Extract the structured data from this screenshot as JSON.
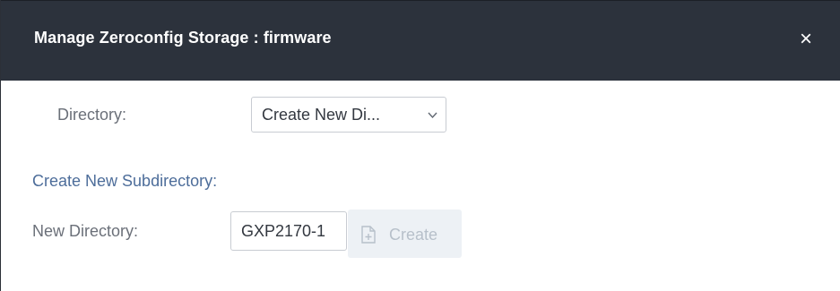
{
  "dialog": {
    "title": "Manage Zeroconfig Storage : firmware",
    "close_glyph": "×",
    "close_icon": "close-icon"
  },
  "directory": {
    "label": "Directory:",
    "selected_value": "Create New Di...",
    "arrow_icon": "chevron-down-icon"
  },
  "subdirectory": {
    "section_title": "Create New Subdirectory:",
    "label": "New Directory:",
    "input_value": "GXP2170-1",
    "create_label": "Create",
    "create_icon": "new-file-icon",
    "create_enabled": false
  },
  "colors": {
    "titlebar": "#2c323c",
    "section_title": "#4d6d9a",
    "label": "#6b7079",
    "disabled_button_bg": "#edf1f5",
    "disabled_button_text": "#b7c0ca"
  }
}
